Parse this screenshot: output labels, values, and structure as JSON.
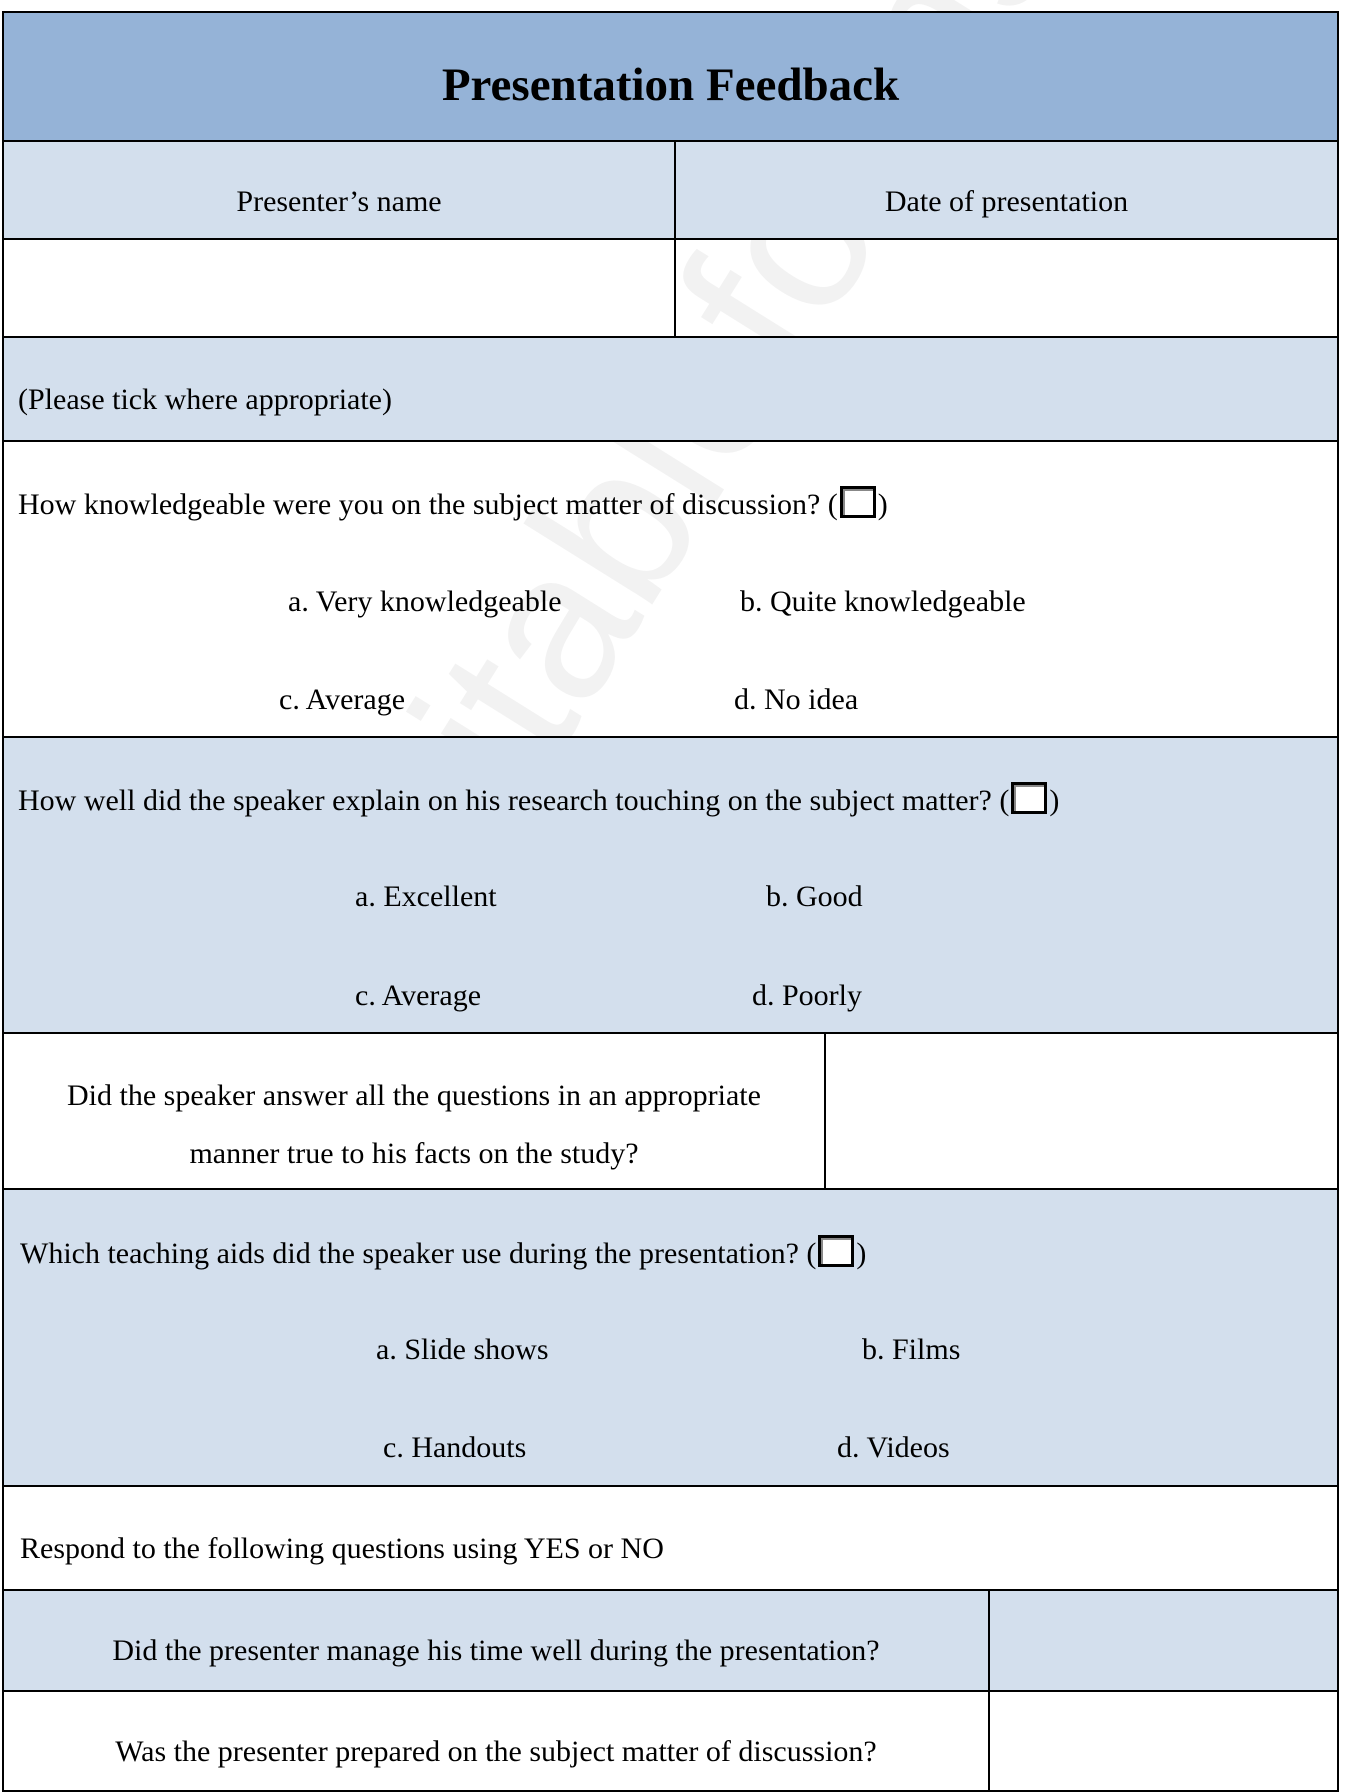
{
  "title": "Presentation Feedback",
  "header": {
    "presenter_name": "Presenter’s name",
    "date": "Date of presentation"
  },
  "instruction": "(Please tick where appropriate)",
  "q1": {
    "text": "How knowledgeable were you on the subject matter of discussion? (",
    "close": ")",
    "options": [
      "a. Very knowledgeable",
      "b. Quite knowledgeable",
      "c. Average",
      "d. No idea"
    ]
  },
  "q2": {
    "text": "How well did the speaker explain on his research touching on the subject matter? (",
    "close": ")",
    "options": [
      "a. Excellent",
      "b. Good",
      "c. Average",
      "d. Poorly"
    ]
  },
  "q3": {
    "line1": "Did the speaker answer all the questions in an appropriate",
    "line2": "manner true to his facts on the study?"
  },
  "q4": {
    "text": "Which teaching aids did the speaker use during the presentation?  (",
    "close": ")",
    "options": [
      "a. Slide shows",
      "b. Films",
      "c. Handouts",
      "d. Videos"
    ]
  },
  "yesno": {
    "heading": "Respond to the following questions using YES or NO",
    "questions": [
      "Did the presenter manage his time well during the presentation?",
      "Was the presenter prepared on the subject matter of discussion?"
    ]
  },
  "watermark": "editableforms.com",
  "colors": {
    "title_bg": "#95b3d7",
    "row_bg": "#d3dfed"
  }
}
